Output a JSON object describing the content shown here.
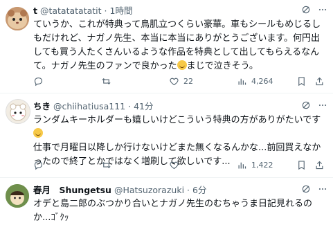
{
  "posts": [
    {
      "name": "t",
      "handle": "@tatatatatatit",
      "dot": "·",
      "time": "1時間",
      "text_before": "ていうか、これが特典って鳥肌立つくらい豪華。車もシールもめじるしもだけれど、ナガノ先生、本当に本当にありがとうございます。何円出しても買う人たくさんいるような作品を特典として出してもらえるなんて。ナガノ先生のファンで良かった",
      "text_after": "まじで泣きそう。",
      "replies": "",
      "reposts": "",
      "likes": "22",
      "views": "4,264"
    },
    {
      "name": "ちき",
      "handle": "@chiihatiusa111",
      "dot": "·",
      "time": "41分",
      "text_before": "ランダムキーホルダーも嬉しいけどこういう特典の方がありがたいです",
      "text_after": "仕事で月曜日以降しか行けないけどまた無くなるんかな...前回買えなかったので終了とかではなく増刷して欲しいです...",
      "replies": "",
      "reposts": "",
      "likes": "",
      "views": "1,422"
    },
    {
      "name": "春月　Shungetsu",
      "handle": "@Hatsuzorazuki",
      "dot": "·",
      "time": "6分",
      "text_before": "オデと島二郎のぶつかり合いとナガノ先生のむちゃうま日記見れるのか...ｺﾞｸｯ",
      "text_after": ""
    }
  ],
  "colors": {
    "text": "#0f1419",
    "muted": "#536471",
    "divider": "#eff3f4"
  }
}
